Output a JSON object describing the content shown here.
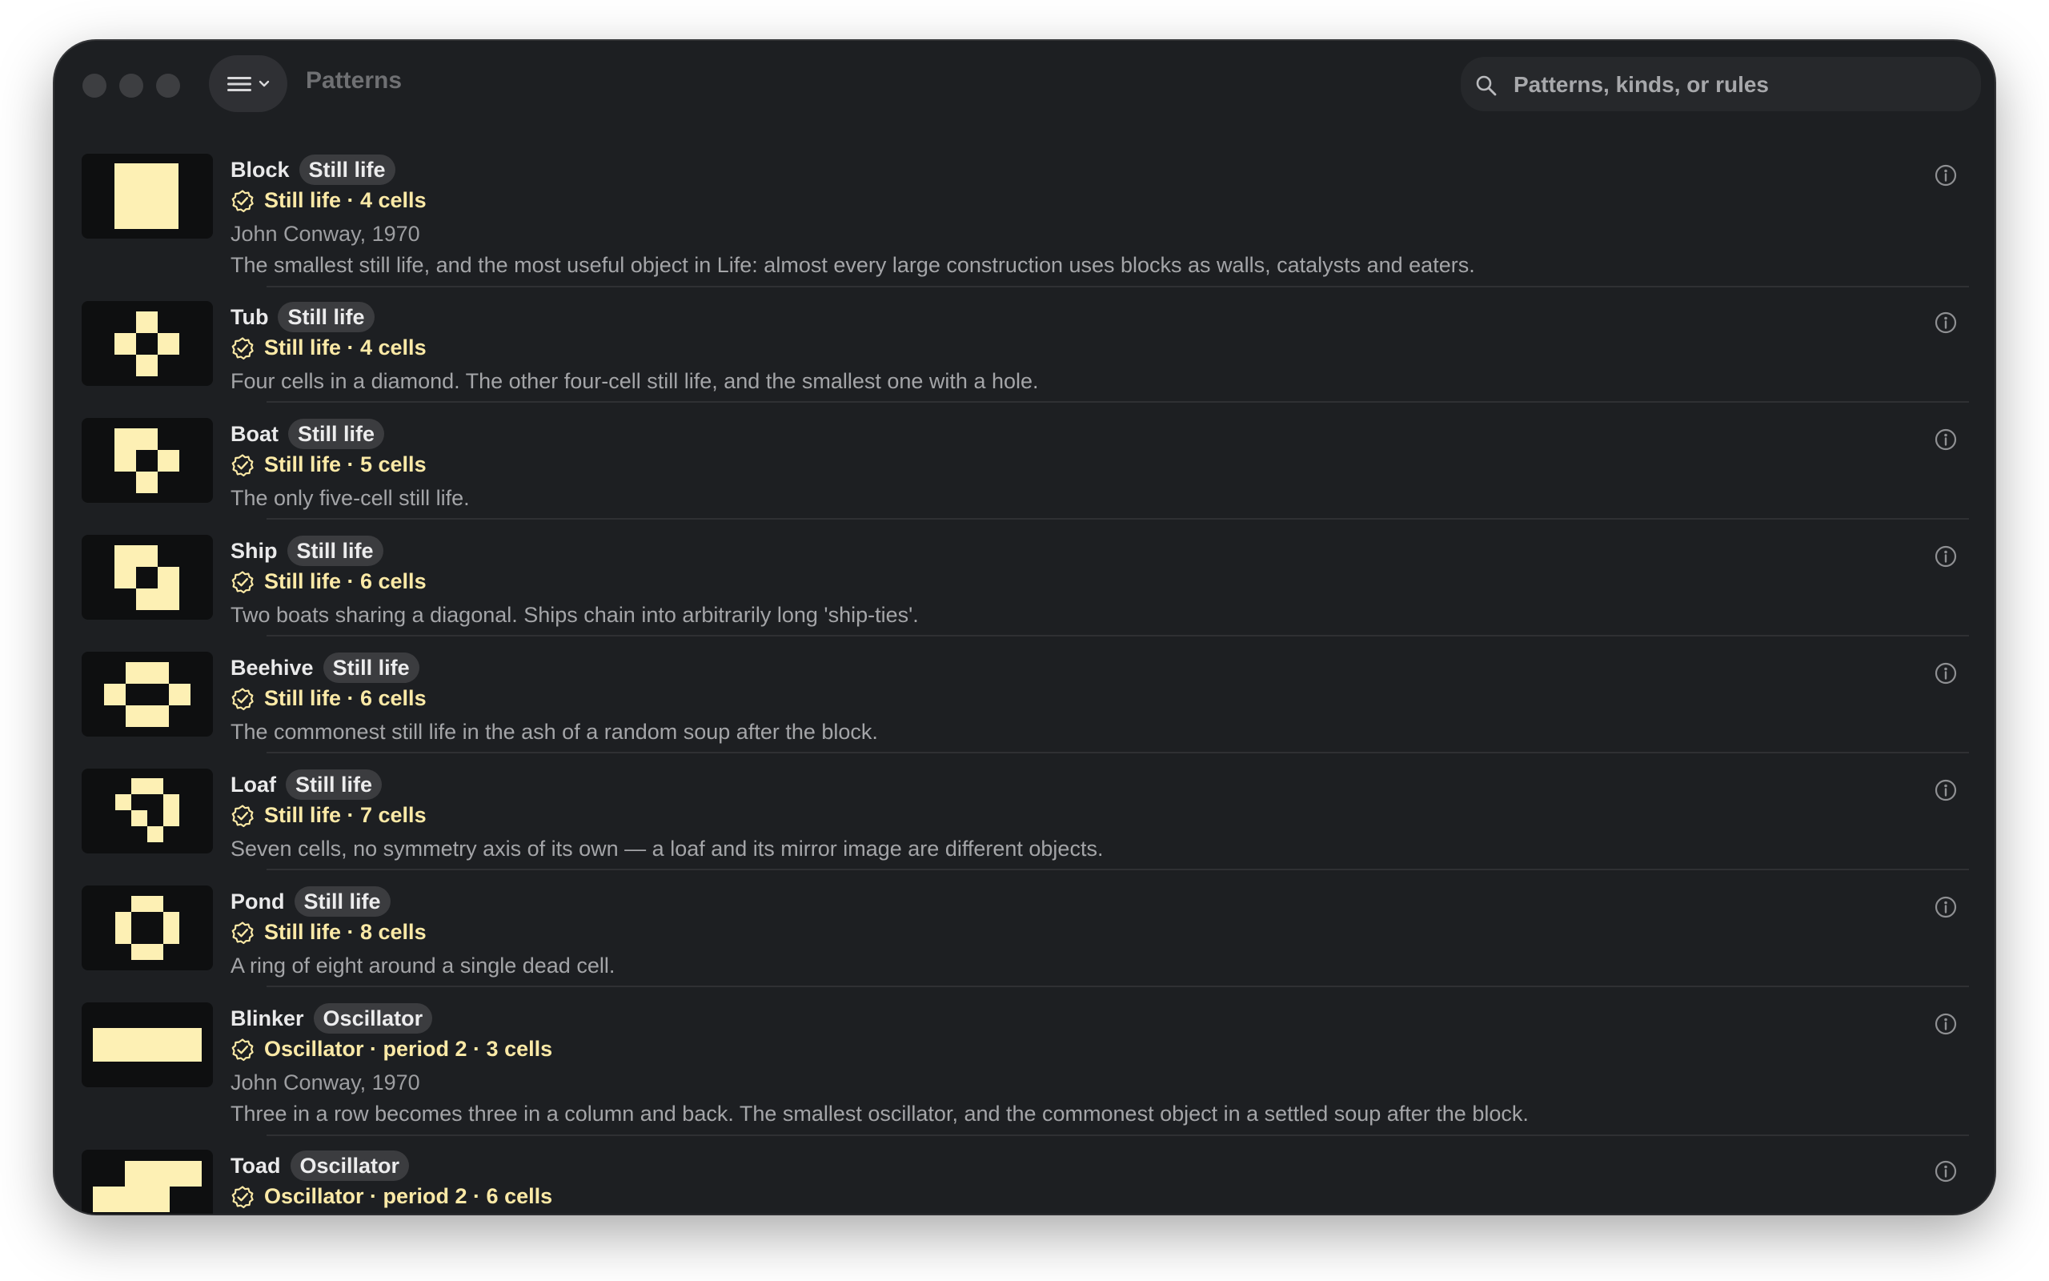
{
  "window": {
    "title": "Patterns"
  },
  "search": {
    "placeholder": "Patterns, kinds, or rules"
  },
  "colors": {
    "cell": "#fdf0b4",
    "accent": "#fbe9a6",
    "background": "#1d1f22"
  },
  "patterns": [
    {
      "name": "Block",
      "kind": "Still life",
      "meta": "Still life · 4 cells",
      "author": "John Conway, 1970",
      "description": "The smallest still life, and the most useful object in Life: almost every large construction uses blocks as walls, catalysts and eaters."
    },
    {
      "name": "Tub",
      "kind": "Still life",
      "meta": "Still life · 4 cells",
      "author": "",
      "description": "Four cells in a diamond. The other four-cell still life, and the smallest one with a hole."
    },
    {
      "name": "Boat",
      "kind": "Still life",
      "meta": "Still life · 5 cells",
      "author": "",
      "description": "The only five-cell still life."
    },
    {
      "name": "Ship",
      "kind": "Still life",
      "meta": "Still life · 6 cells",
      "author": "",
      "description": "Two boats sharing a diagonal. Ships chain into arbitrarily long 'ship-ties'."
    },
    {
      "name": "Beehive",
      "kind": "Still life",
      "meta": "Still life · 6 cells",
      "author": "",
      "description": "The commonest still life in the ash of a random soup after the block."
    },
    {
      "name": "Loaf",
      "kind": "Still life",
      "meta": "Still life · 7 cells",
      "author": "",
      "description": "Seven cells, no symmetry axis of its own — a loaf and its mirror image are different objects."
    },
    {
      "name": "Pond",
      "kind": "Still life",
      "meta": "Still life · 8 cells",
      "author": "",
      "description": "A ring of eight around a single dead cell."
    },
    {
      "name": "Blinker",
      "kind": "Oscillator",
      "meta": "Oscillator · period 2 · 3 cells",
      "author": "John Conway, 1970",
      "description": "Three in a row becomes three in a column and back. The smallest oscillator, and the commonest object in a settled soup after the block."
    },
    {
      "name": "Toad",
      "kind": "Oscillator",
      "meta": "Oscillator · period 2 · 6 cells",
      "author": "",
      "description": ""
    }
  ]
}
